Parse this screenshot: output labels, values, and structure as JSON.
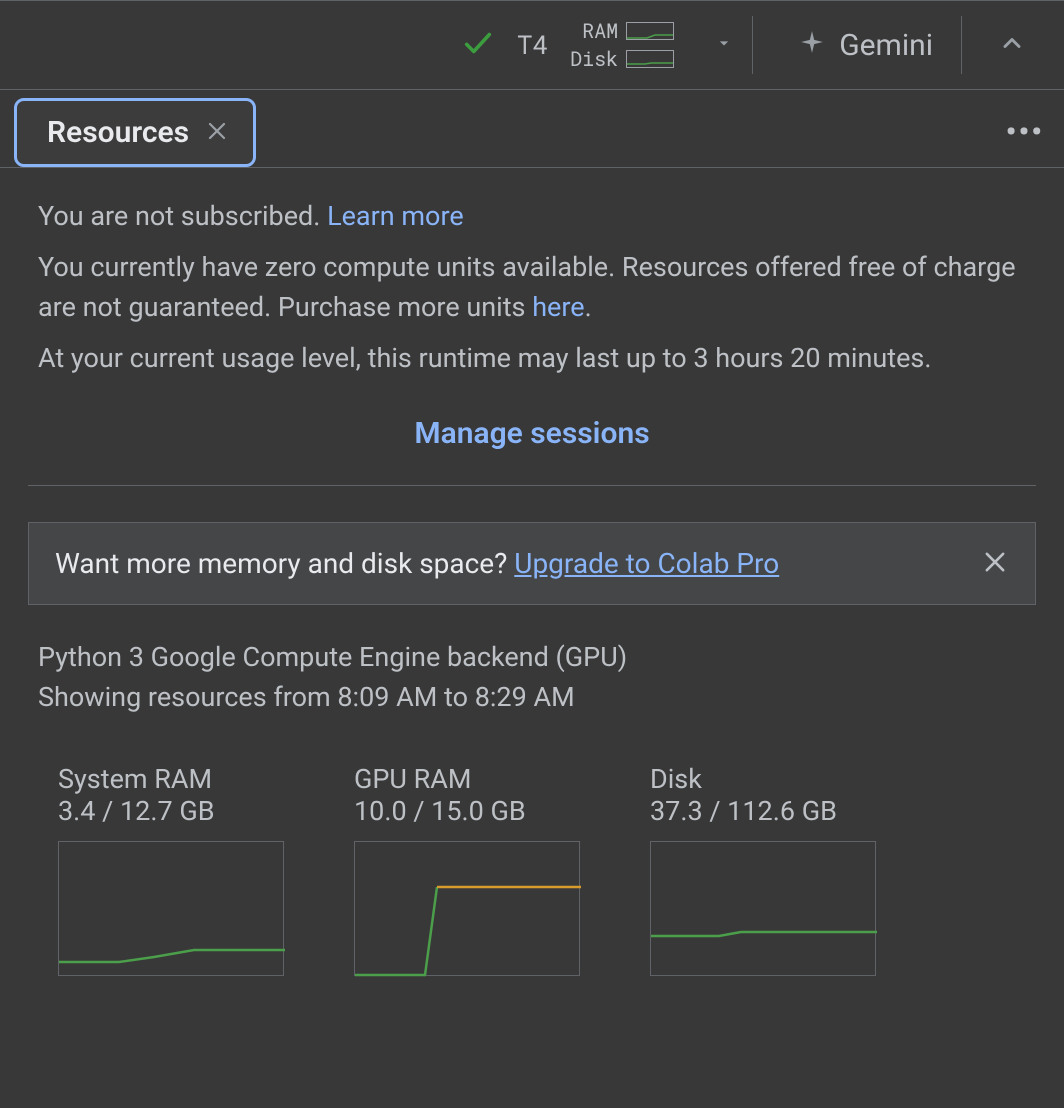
{
  "topbar": {
    "gpu": "T4",
    "ram_label": "RAM",
    "disk_label": "Disk",
    "gemini": "Gemini"
  },
  "tab": {
    "title": "Resources"
  },
  "info": {
    "not_subscribed": "You are not subscribed. ",
    "learn_more": "Learn more",
    "zero_units_a": "You currently have zero compute units available. Resources offered free of charge are not guaranteed. Purchase more units ",
    "here": "here",
    "period": ".",
    "usage_level": "At your current usage level, this runtime may last up to 3 hours 20 minutes.",
    "manage_sessions": "Manage sessions"
  },
  "upgrade": {
    "prompt": "Want more memory and disk space? ",
    "link": "Upgrade to Colab Pro"
  },
  "backend": {
    "line1": "Python 3 Google Compute Engine backend (GPU)",
    "line2": "Showing resources from 8:09 AM to 8:29 AM"
  },
  "charts": {
    "system_ram": {
      "title": "System RAM",
      "value": "3.4 / 12.7 GB"
    },
    "gpu_ram": {
      "title": "GPU RAM",
      "value": "10.0 / 15.0 GB"
    },
    "disk": {
      "title": "Disk",
      "value": "37.3 / 112.6 GB"
    }
  },
  "chart_data": [
    {
      "type": "line",
      "title": "System RAM",
      "ylabel": "GB",
      "ylim": [
        0,
        12.7
      ],
      "x": [
        0,
        5,
        10,
        12,
        14,
        20
      ],
      "values": [
        1.4,
        1.4,
        1.5,
        2.2,
        2.5,
        2.5
      ]
    },
    {
      "type": "line",
      "title": "GPU RAM",
      "ylabel": "GB",
      "ylim": [
        0,
        15.0
      ],
      "x": [
        0,
        6,
        7,
        20
      ],
      "values": [
        0.0,
        0.0,
        10.0,
        10.0
      ]
    },
    {
      "type": "line",
      "title": "Disk",
      "ylabel": "GB",
      "ylim": [
        0,
        112.6
      ],
      "x": [
        0,
        6,
        8,
        20
      ],
      "values": [
        35.0,
        35.0,
        37.3,
        37.3
      ]
    }
  ]
}
